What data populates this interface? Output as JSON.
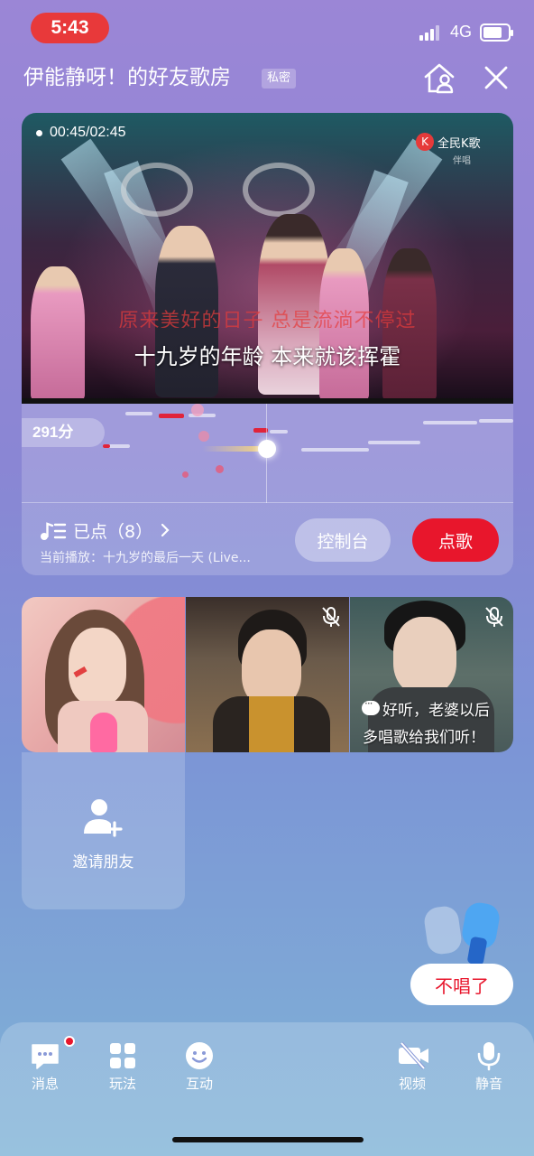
{
  "status_bar": {
    "time": "5:43",
    "network": "4G",
    "battery_level": 0.75
  },
  "header": {
    "room_title": "伊能静呀！的好友歌房",
    "private_badge": "私密",
    "home_icon": "house-person-icon",
    "close_icon": "close-icon"
  },
  "player": {
    "play_time": "00:45/02:45",
    "brand": "全民K歌",
    "brand_sub": "伴唱",
    "lyric_previous": "原来美好的日子 总是流淌不停过",
    "lyric_current": "十九岁的年龄 本来就该挥霍",
    "score": "291分",
    "queue_label": "已点（8）",
    "now_playing": "当前播放：十九岁的最后一天 (Live...",
    "console_button": "控制台",
    "order_button": "点歌"
  },
  "tiles": {
    "comment_line1": "好听，老婆以后",
    "comment_line2": "多唱歌给我们听！",
    "muted_icon": "mic-muted-icon"
  },
  "invite": {
    "label": "邀请朋友",
    "icon": "add-user-icon"
  },
  "stop_button": "不唱了",
  "bottom_nav": [
    {
      "label": "消息",
      "icon": "message-icon"
    },
    {
      "label": "玩法",
      "icon": "grid-icon"
    },
    {
      "label": "互动",
      "icon": "smile-icon"
    },
    {
      "label": "视频",
      "icon": "camera-off-icon"
    },
    {
      "label": "静音",
      "icon": "mic-icon"
    }
  ],
  "colors": {
    "accent_red": "#e8162c",
    "time_pill": "#e8393a"
  }
}
